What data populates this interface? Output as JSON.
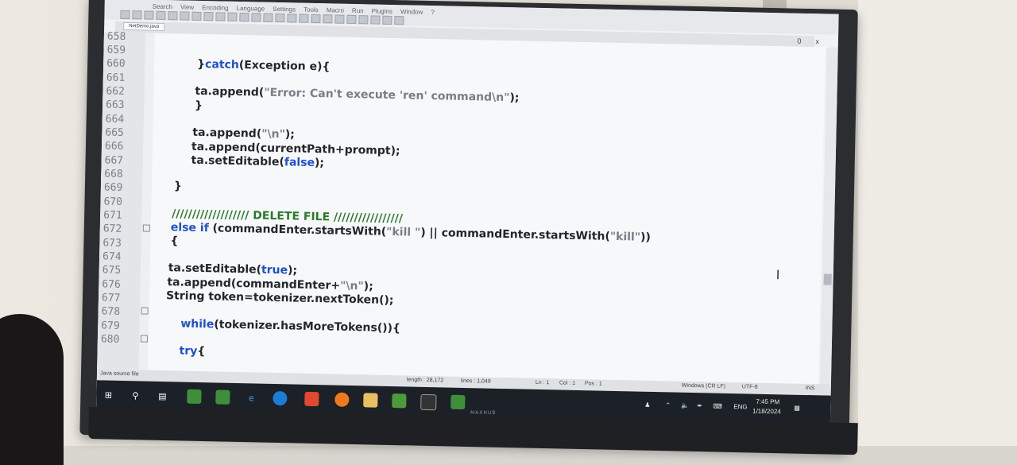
{
  "app": {
    "menu": [
      "Search",
      "View",
      "Encoding",
      "Language",
      "Settings",
      "Tools",
      "Macro",
      "Run",
      "Plugins",
      "Window",
      "?"
    ],
    "tab": "NetDemo.java",
    "window_controls": [
      "0",
      "x"
    ]
  },
  "editor": {
    "line_numbers": [
      "658",
      "659",
      "660",
      "661",
      "662",
      "663",
      "664",
      "665",
      "666",
      "667",
      "668",
      "669",
      "670",
      "671",
      "672",
      "673",
      "674",
      "675",
      "676",
      "677",
      "678",
      "679",
      "680"
    ],
    "lines": {
      "l660_close": "}",
      "l660_kw": "catch",
      "l660_rest": "(Exception e){",
      "l662_call": "ta.append(",
      "l662_str": "\"Error: Can't execute 'ren' command\\n\"",
      "l662_end": ");",
      "l663": "}",
      "l665_call": "ta.append(",
      "l665_str": "\"\\n\"",
      "l665_end": ");",
      "l666": "ta.append(currentPath+prompt);",
      "l667_a": "ta.setEditable(",
      "l667_kw": "false",
      "l667_b": ");",
      "l669": "}",
      "l671": "/////////////////// DELETE FILE /////////////////",
      "l672_kw1": "else if",
      "l672_a": " (commandEnter.startsWith(",
      "l672_s1": "\"kill \"",
      "l672_b": ") || commandEnter.startsWith(",
      "l672_s2": "\"kill\"",
      "l672_c": "))",
      "l673": "{",
      "l675_a": "ta.setEditable(",
      "l675_kw": "true",
      "l675_b": ");",
      "l676_a": "ta.append(commandEnter+",
      "l676_s": "\"\\n\"",
      "l676_b": ");",
      "l677": "String token=tokenizer.nextToken();",
      "l679_kw": "while",
      "l679_rest": "(tokenizer.hasMoreTokens()){",
      "l681_kw": "try",
      "l681_rest": "{"
    },
    "cursor_glyph": "I"
  },
  "statusbar": {
    "file_type": "Java source file",
    "length": "length : 28,172",
    "lines": "lines : 1,049",
    "ln": "Ln : 1",
    "col": "Col : 1",
    "pos": "Pos : 1",
    "eol": "Windows (CR LF)",
    "encoding": "UTF-8",
    "mode": "INS"
  },
  "taskbar": {
    "language": "ENG",
    "time": "7:45 PM",
    "date": "1/18/2024"
  },
  "tv": {
    "brand": "MAXHUB"
  }
}
